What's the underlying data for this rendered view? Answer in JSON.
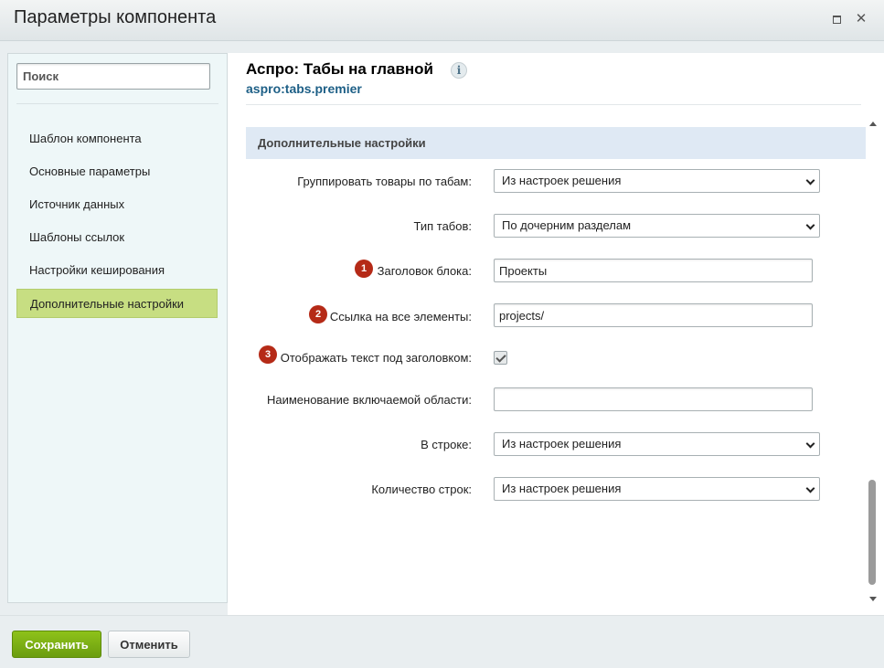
{
  "window": {
    "title": "Параметры компонента"
  },
  "sidebar": {
    "search_placeholder": "Поиск",
    "items": [
      {
        "label": "Шаблон компонента"
      },
      {
        "label": "Основные параметры"
      },
      {
        "label": "Источник данных"
      },
      {
        "label": "Шаблоны ссылок"
      },
      {
        "label": "Настройки кеширования"
      },
      {
        "label": "Дополнительные настройки",
        "active": true
      }
    ]
  },
  "component": {
    "title": "Аспро: Табы на главной",
    "code": "aspro:tabs.premier",
    "info_icon": "info-icon"
  },
  "section": {
    "title": "Дополнительные настройки"
  },
  "fields": {
    "group_by_tabs": {
      "label": "Группировать товары по табам:",
      "value": "Из настроек решения"
    },
    "tabs_type": {
      "label": "Тип табов:",
      "value": "По дочерним разделам"
    },
    "block_title": {
      "label": "Заголовок блока:",
      "value": "Проекты",
      "badge": "1"
    },
    "all_link": {
      "label": "Ссылка на все элементы:",
      "value": "projects/",
      "badge": "2"
    },
    "show_text": {
      "label": "Отображать текст под заголовком:",
      "checked": true,
      "badge": "3"
    },
    "include_area": {
      "label": "Наименование включаемой области:",
      "value": ""
    },
    "per_row": {
      "label": "В строке:",
      "value": "Из настроек решения"
    },
    "rows_count": {
      "label": "Количество строк:",
      "value": "Из настроек решения"
    }
  },
  "footer": {
    "save_label": "Сохранить",
    "cancel_label": "Отменить"
  },
  "colors": {
    "accent_green": "#7fb015",
    "active_nav": "#c7de82",
    "badge_red": "#b52a17",
    "link_blue": "#1d5f86"
  }
}
